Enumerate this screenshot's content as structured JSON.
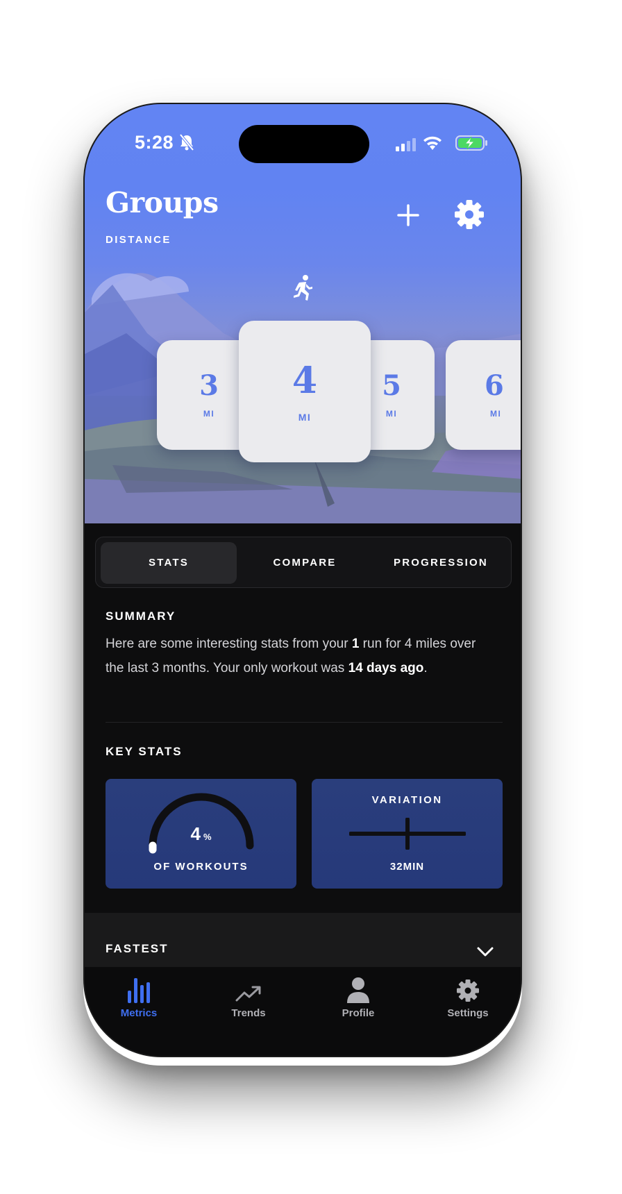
{
  "status": {
    "time": "5:28"
  },
  "header": {
    "title": "Groups",
    "subtitle": "DISTANCE"
  },
  "distance_cards": [
    {
      "value": "3",
      "unit": "MI"
    },
    {
      "value": "4",
      "unit": "MI",
      "selected": true
    },
    {
      "value": "5",
      "unit": "MI"
    },
    {
      "value": "6",
      "unit": "MI"
    }
  ],
  "tabs": [
    {
      "label": "STATS",
      "active": true
    },
    {
      "label": "COMPARE",
      "active": false
    },
    {
      "label": "PROGRESSION",
      "active": false
    }
  ],
  "summary": {
    "heading": "SUMMARY",
    "text_1": "Here are some interesting stats from your ",
    "runs_count": "1",
    "text_2": " run for 4 miles over the last 3 months. Your only workout was ",
    "last_workout": "14 days ago",
    "text_3": "."
  },
  "key_stats": {
    "heading": "KEY STATS",
    "workouts_percent": "4",
    "percent_unit": "%",
    "workouts_label": "OF WORKOUTS",
    "variation_title": "VARIATION",
    "variation_value": "32MIN"
  },
  "fastest": {
    "heading": "FASTEST"
  },
  "nav": [
    {
      "label": "Metrics",
      "icon": "bar-chart-icon",
      "active": true
    },
    {
      "label": "Trends",
      "icon": "trend-line-icon",
      "active": false
    },
    {
      "label": "Profile",
      "icon": "person-icon",
      "active": false
    },
    {
      "label": "Settings",
      "icon": "gear-icon",
      "active": false
    }
  ],
  "colors": {
    "accent": "#5b7ae6",
    "hero_blue": "#6284f3",
    "card_navy": "#283c7b",
    "background": "#0d0d0e",
    "nav_active": "#3f6ff0"
  }
}
